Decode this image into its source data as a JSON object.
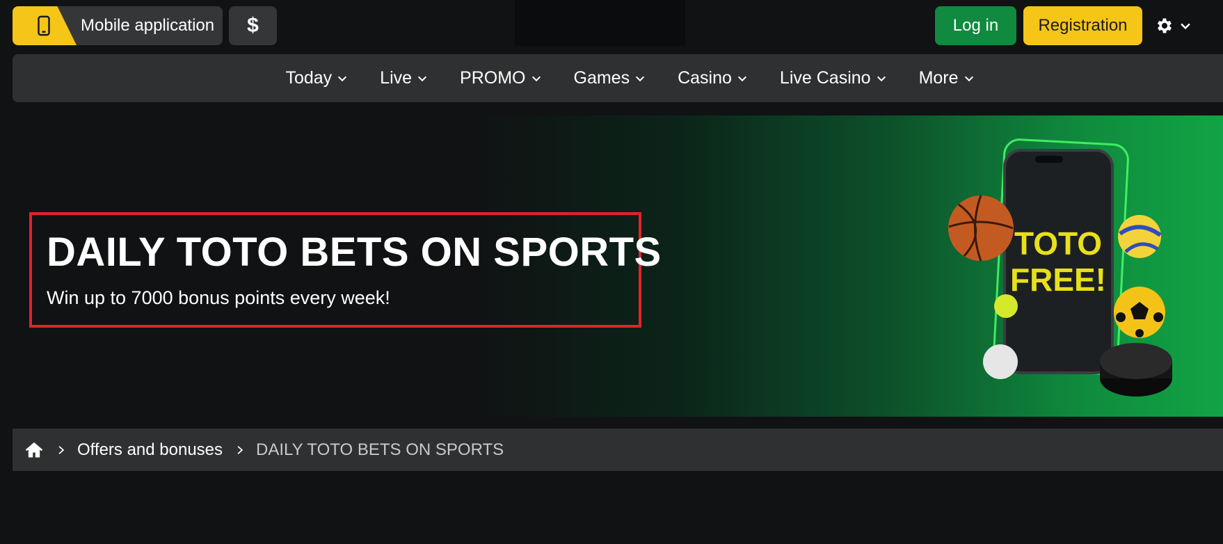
{
  "header": {
    "mobile_app_label": "Mobile application",
    "currency_symbol": "$",
    "login_label": "Log in",
    "register_label": "Registration"
  },
  "nav": {
    "items": [
      {
        "label": "Today"
      },
      {
        "label": "Live"
      },
      {
        "label": "PROMO"
      },
      {
        "label": "Games"
      },
      {
        "label": "Casino"
      },
      {
        "label": "Live Casino"
      },
      {
        "label": "More"
      }
    ]
  },
  "banner": {
    "title": "DAILY TOTO BETS ON SPORTS",
    "subtitle": "Win up to 7000 bonus points every week!",
    "phone_text_line1": "TOTO",
    "phone_text_line2": "FREE!"
  },
  "breadcrumb": {
    "link": "Offers and bonuses",
    "current": "DAILY TOTO BETS ON SPORTS"
  },
  "colors": {
    "accent_yellow": "#f5c518",
    "login_green": "#0f8a3f",
    "highlight_red": "#e1232b",
    "panel_grey": "#2f3031"
  },
  "icons": [
    "phone-icon",
    "dollar-icon",
    "gear-icon",
    "chevron-down-icon",
    "home-icon",
    "chevron-right-icon"
  ]
}
